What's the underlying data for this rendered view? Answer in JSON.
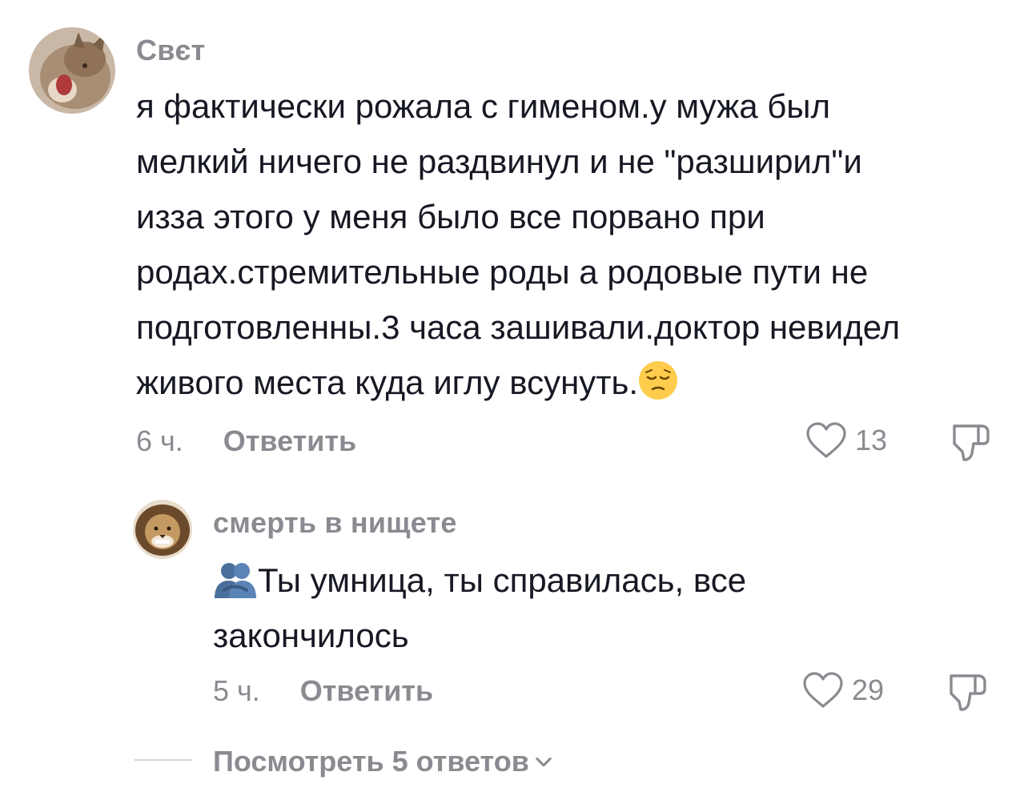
{
  "comment": {
    "username": "Свєт",
    "text_lines": [
      "я фактически рожала с гименом.у мужа был",
      "мелкий ничего не раздвинул и не \"разширил\"и",
      "изза этого у меня было все порвано при",
      "родах.стремительные роды а родовые пути не",
      "подготовленны.3 часа зашивали.доктор невидел",
      "живого места куда иглу всунуть."
    ],
    "emoji": "pensive-face",
    "time": "6 ч.",
    "reply_label": "Ответить",
    "likes": "13"
  },
  "reply": {
    "username": "смерть в нищете",
    "emoji": "people-hugging",
    "text_lines": [
      "Ты умница, ты справилась, все",
      "закончилось"
    ],
    "time": "5 ч.",
    "reply_label": "Ответить",
    "likes": "29"
  },
  "view_more": {
    "label": "Посмотреть 5 ответов"
  },
  "colors": {
    "text": "#161823",
    "muted": "#8a8b91",
    "divider": "#d6d6d9"
  }
}
